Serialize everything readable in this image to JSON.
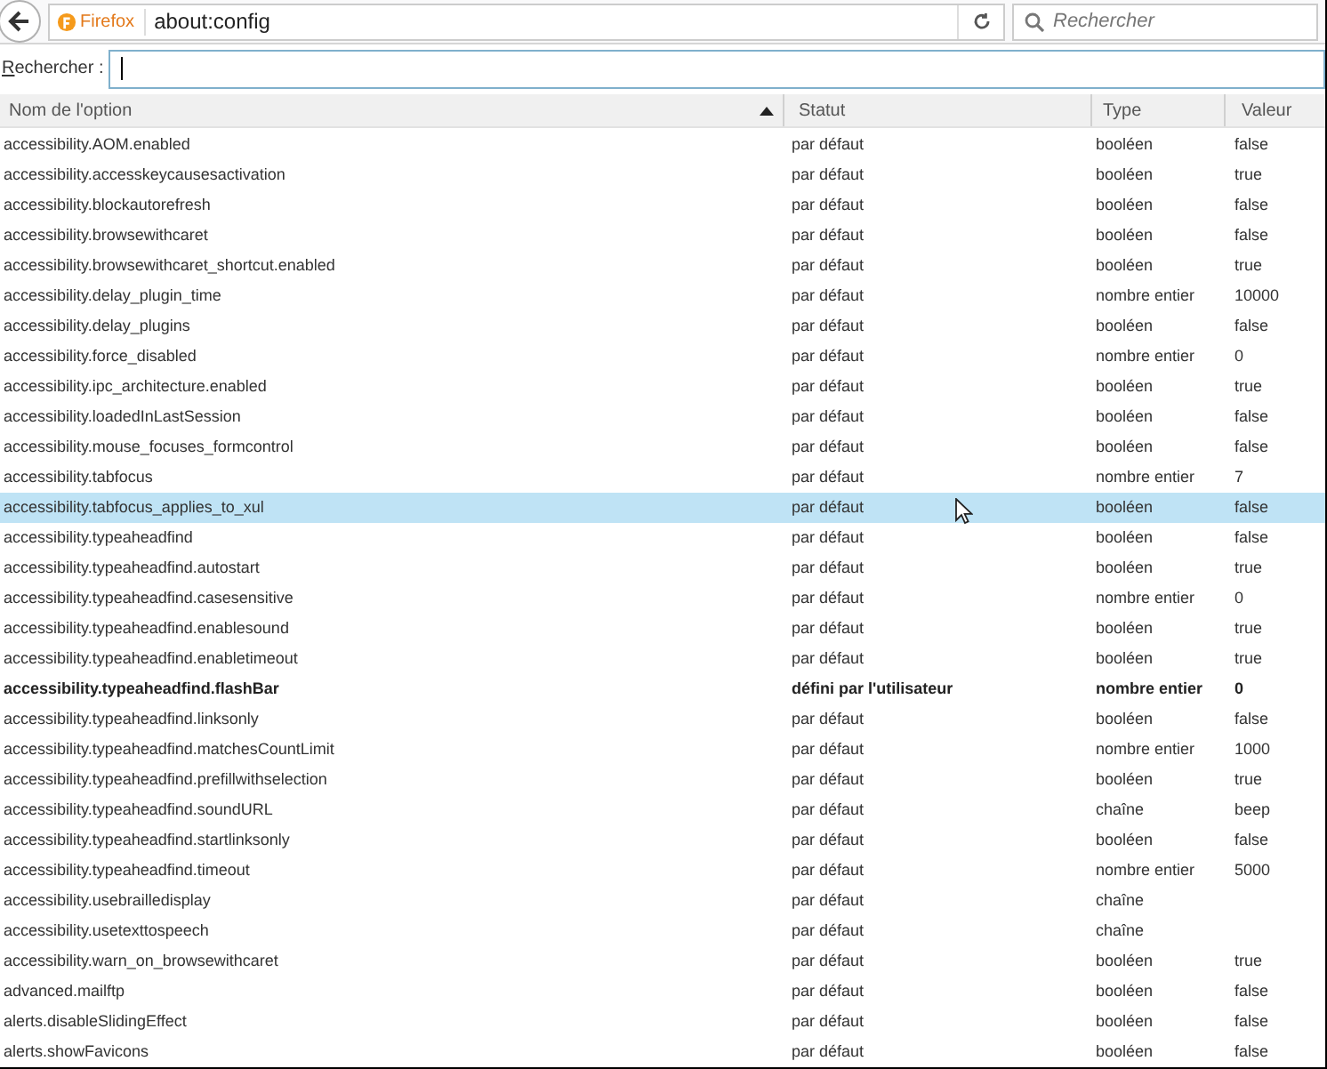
{
  "toolbar": {
    "identity": "Firefox",
    "url": "about:config",
    "search_placeholder": "Rechercher"
  },
  "filter": {
    "label": "Rechercher :"
  },
  "table": {
    "columns": [
      {
        "label": "Nom de l'option",
        "sorted": true
      },
      {
        "label": "Statut",
        "sorted": false
      },
      {
        "label": "Type",
        "sorted": false
      },
      {
        "label": "Valeur",
        "sorted": false
      }
    ],
    "rows": [
      {
        "name": "accessibility.AOM.enabled",
        "status": "par défaut",
        "type": "booléen",
        "value": "false",
        "modified": false,
        "selected": false
      },
      {
        "name": "accessibility.accesskeycausesactivation",
        "status": "par défaut",
        "type": "booléen",
        "value": "true",
        "modified": false,
        "selected": false
      },
      {
        "name": "accessibility.blockautorefresh",
        "status": "par défaut",
        "type": "booléen",
        "value": "false",
        "modified": false,
        "selected": false
      },
      {
        "name": "accessibility.browsewithcaret",
        "status": "par défaut",
        "type": "booléen",
        "value": "false",
        "modified": false,
        "selected": false
      },
      {
        "name": "accessibility.browsewithcaret_shortcut.enabled",
        "status": "par défaut",
        "type": "booléen",
        "value": "true",
        "modified": false,
        "selected": false
      },
      {
        "name": "accessibility.delay_plugin_time",
        "status": "par défaut",
        "type": "nombre entier",
        "value": "10000",
        "modified": false,
        "selected": false
      },
      {
        "name": "accessibility.delay_plugins",
        "status": "par défaut",
        "type": "booléen",
        "value": "false",
        "modified": false,
        "selected": false
      },
      {
        "name": "accessibility.force_disabled",
        "status": "par défaut",
        "type": "nombre entier",
        "value": "0",
        "modified": false,
        "selected": false
      },
      {
        "name": "accessibility.ipc_architecture.enabled",
        "status": "par défaut",
        "type": "booléen",
        "value": "true",
        "modified": false,
        "selected": false
      },
      {
        "name": "accessibility.loadedInLastSession",
        "status": "par défaut",
        "type": "booléen",
        "value": "false",
        "modified": false,
        "selected": false
      },
      {
        "name": "accessibility.mouse_focuses_formcontrol",
        "status": "par défaut",
        "type": "booléen",
        "value": "false",
        "modified": false,
        "selected": false
      },
      {
        "name": "accessibility.tabfocus",
        "status": "par défaut",
        "type": "nombre entier",
        "value": "7",
        "modified": false,
        "selected": false
      },
      {
        "name": "accessibility.tabfocus_applies_to_xul",
        "status": "par défaut",
        "type": "booléen",
        "value": "false",
        "modified": false,
        "selected": true
      },
      {
        "name": "accessibility.typeaheadfind",
        "status": "par défaut",
        "type": "booléen",
        "value": "false",
        "modified": false,
        "selected": false
      },
      {
        "name": "accessibility.typeaheadfind.autostart",
        "status": "par défaut",
        "type": "booléen",
        "value": "true",
        "modified": false,
        "selected": false
      },
      {
        "name": "accessibility.typeaheadfind.casesensitive",
        "status": "par défaut",
        "type": "nombre entier",
        "value": "0",
        "modified": false,
        "selected": false
      },
      {
        "name": "accessibility.typeaheadfind.enablesound",
        "status": "par défaut",
        "type": "booléen",
        "value": "true",
        "modified": false,
        "selected": false
      },
      {
        "name": "accessibility.typeaheadfind.enabletimeout",
        "status": "par défaut",
        "type": "booléen",
        "value": "true",
        "modified": false,
        "selected": false
      },
      {
        "name": "accessibility.typeaheadfind.flashBar",
        "status": "défini par l'utilisateur",
        "type": "nombre entier",
        "value": "0",
        "modified": true,
        "selected": false
      },
      {
        "name": "accessibility.typeaheadfind.linksonly",
        "status": "par défaut",
        "type": "booléen",
        "value": "false",
        "modified": false,
        "selected": false
      },
      {
        "name": "accessibility.typeaheadfind.matchesCountLimit",
        "status": "par défaut",
        "type": "nombre entier",
        "value": "1000",
        "modified": false,
        "selected": false
      },
      {
        "name": "accessibility.typeaheadfind.prefillwithselection",
        "status": "par défaut",
        "type": "booléen",
        "value": "true",
        "modified": false,
        "selected": false
      },
      {
        "name": "accessibility.typeaheadfind.soundURL",
        "status": "par défaut",
        "type": "chaîne",
        "value": "beep",
        "modified": false,
        "selected": false
      },
      {
        "name": "accessibility.typeaheadfind.startlinksonly",
        "status": "par défaut",
        "type": "booléen",
        "value": "false",
        "modified": false,
        "selected": false
      },
      {
        "name": "accessibility.typeaheadfind.timeout",
        "status": "par défaut",
        "type": "nombre entier",
        "value": "5000",
        "modified": false,
        "selected": false
      },
      {
        "name": "accessibility.usebrailledisplay",
        "status": "par défaut",
        "type": "chaîne",
        "modified": false,
        "selected": false
      },
      {
        "name": "accessibility.usetexttospeech",
        "status": "par défaut",
        "type": "chaîne",
        "modified": false,
        "selected": false
      },
      {
        "name": "accessibility.warn_on_browsewithcaret",
        "status": "par défaut",
        "type": "booléen",
        "value": "true",
        "modified": false,
        "selected": false
      },
      {
        "name": "advanced.mailftp",
        "status": "par défaut",
        "type": "booléen",
        "value": "false",
        "modified": false,
        "selected": false
      },
      {
        "name": "alerts.disableSlidingEffect",
        "status": "par défaut",
        "type": "booléen",
        "value": "false",
        "modified": false,
        "selected": false
      },
      {
        "name": "alerts.showFavicons",
        "status": "par défaut",
        "type": "booléen",
        "value": "false",
        "modified": false,
        "selected": false
      }
    ]
  }
}
